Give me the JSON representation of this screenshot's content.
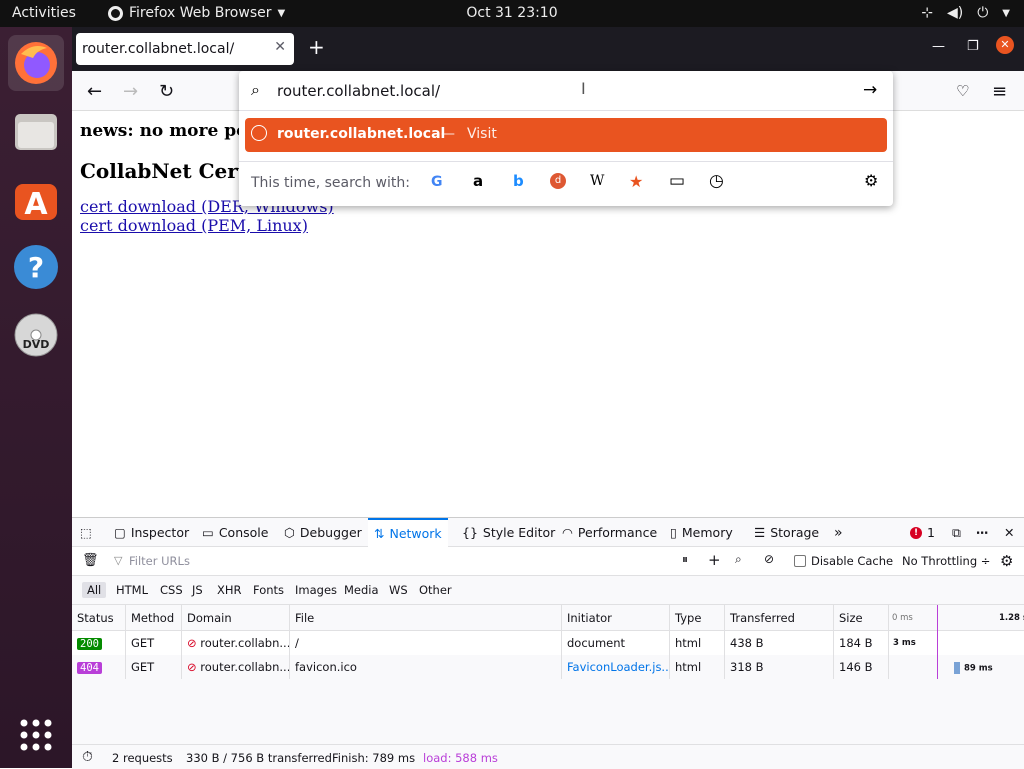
{
  "topbar": {
    "activities": "Activities",
    "app_name": "Firefox Web Browser",
    "clock": "Oct 31  23:10"
  },
  "browser": {
    "tab_title": "router.collabnet.local/",
    "url": "router.collabnet.local/"
  },
  "url_dropdown": {
    "result_host": "router.collabnet.local",
    "result_sep": "—",
    "result_action": "Visit",
    "search_with_label": "This time, search with:",
    "engines": [
      "G",
      "a",
      "b",
      "d",
      "W",
      "★",
      "▭",
      "◷"
    ]
  },
  "page": {
    "news": "news: no more po",
    "heading": "CollabNet Certi",
    "links": [
      "cert download (DER, Windows)",
      "cert download (PEM, Linux)"
    ]
  },
  "devtools": {
    "tabs": [
      "Inspector",
      "Console",
      "Debugger",
      "Network",
      "Style Editor",
      "Performance",
      "Memory",
      "Storage"
    ],
    "active_tab": "Network",
    "error_count": "1",
    "filter_placeholder": "Filter URLs",
    "disable_cache": "Disable Cache",
    "throttling": "No Throttling ÷",
    "filters": [
      "All",
      "HTML",
      "CSS",
      "JS",
      "XHR",
      "Fonts",
      "Images",
      "Media",
      "WS",
      "Other"
    ],
    "columns": [
      "Status",
      "Method",
      "Domain",
      "File",
      "Initiator",
      "Type",
      "Transferred",
      "Size"
    ],
    "waterfall_ticks": [
      "0 ms",
      "1.28 s"
    ],
    "requests": [
      {
        "status": "200",
        "method": "GET",
        "domain": "router.collabn...",
        "file": "/",
        "initiator": "document",
        "type": "html",
        "transferred": "438 B",
        "size": "184 B",
        "timing": "3 ms",
        "status_color": "#058b00"
      },
      {
        "status": "404",
        "method": "GET",
        "domain": "router.collabn...",
        "file": "favicon.ico",
        "initiator": "FaviconLoader.js...",
        "type": "html",
        "transferred": "318 B",
        "size": "146 B",
        "timing": "89 ms",
        "status_color": "#b93fd8"
      }
    ],
    "status_bar": {
      "requests": "2 requests",
      "transferred": "330 B / 756 B transferred",
      "finish": "Finish: 789 ms",
      "load": "load: 588 ms"
    }
  },
  "colors": {
    "accent": "#e95420",
    "devtools_active": "#0074e8",
    "load": "#b93fd8"
  }
}
